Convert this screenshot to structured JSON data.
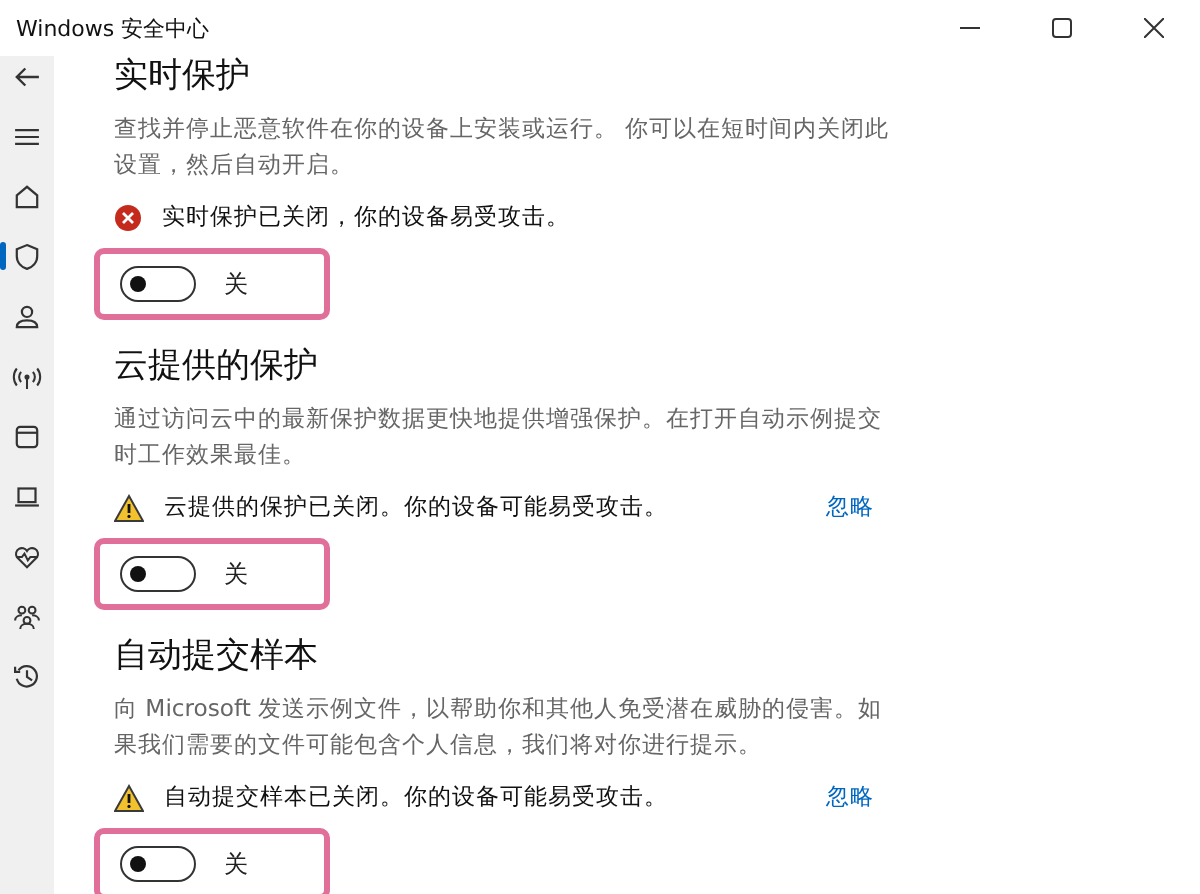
{
  "window": {
    "title": "Windows 安全中心"
  },
  "nav": [
    {
      "selected": false
    },
    {
      "selected": false
    },
    {
      "selected": false
    },
    {
      "selected": true
    },
    {
      "selected": false
    },
    {
      "selected": false
    },
    {
      "selected": false
    },
    {
      "selected": false
    },
    {
      "selected": false
    },
    {
      "selected": false
    },
    {
      "selected": false
    }
  ],
  "sections": [
    {
      "title": "实时保护",
      "description": "查找并停止恶意软件在你的设备上安装或运行。 你可以在短时间内关闭此设置，然后自动开启。",
      "status": {
        "kind": "error",
        "text": "实时保护已关闭，你的设备易受攻击。"
      },
      "toggle": {
        "on": false,
        "label": "关"
      },
      "highlighted": true
    },
    {
      "title": "云提供的保护",
      "description": "通过访问云中的最新保护数据更快地提供增强保护。在打开自动示例提交时工作效果最佳。",
      "status": {
        "kind": "warning",
        "text": "云提供的保护已关闭。你的设备可能易受攻击。",
        "action": "忽略"
      },
      "toggle": {
        "on": false,
        "label": "关"
      },
      "highlighted": true
    },
    {
      "title": "自动提交样本",
      "description": "向 Microsoft 发送示例文件，以帮助你和其他人免受潜在威胁的侵害。如果我们需要的文件可能包含个人信息，我们将对你进行提示。",
      "status": {
        "kind": "warning",
        "text": "自动提交样本已关闭。你的设备可能易受攻击。",
        "action": "忽略"
      },
      "toggle": {
        "on": false,
        "label": "关"
      },
      "highlighted": true
    }
  ]
}
